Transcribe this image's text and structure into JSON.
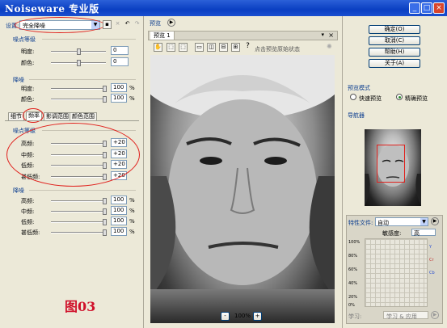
{
  "window": {
    "title": "Noiseware 专业版",
    "buttons": [
      "_",
      "□",
      "×"
    ]
  },
  "settings": {
    "label": "设置:",
    "value": "完全降噪"
  },
  "noise_level": {
    "title": "噪点等级",
    "rows": [
      {
        "label": "明度:",
        "value": "0"
      },
      {
        "label": "颜色:",
        "value": "0"
      }
    ]
  },
  "noise_reduction": {
    "title": "降噪",
    "rows": [
      {
        "label": "明度:",
        "value": "100",
        "unit": "%"
      },
      {
        "label": "颜色:",
        "value": "100",
        "unit": "%"
      }
    ]
  },
  "tabs": [
    "细节",
    "频率",
    "影调范围",
    "颜色范围"
  ],
  "freq_noise": {
    "title": "噪点等级",
    "rows": [
      {
        "label": "高频:",
        "value": "+20"
      },
      {
        "label": "中频:",
        "value": "+20"
      },
      {
        "label": "低频:",
        "value": "+20"
      },
      {
        "label": "甚低频:",
        "value": "+20"
      }
    ]
  },
  "freq_reduction": {
    "title": "降噪",
    "rows": [
      {
        "label": "高频:",
        "value": "100",
        "unit": "%"
      },
      {
        "label": "中频:",
        "value": "100",
        "unit": "%"
      },
      {
        "label": "低频:",
        "value": "100",
        "unit": "%"
      },
      {
        "label": "甚低频:",
        "value": "100",
        "unit": "%"
      }
    ]
  },
  "figure_label": "图03",
  "preview": {
    "section": "预览",
    "tab": "预览 1",
    "hint": "点击预览原始状态",
    "zoom": "100%",
    "minus": "-",
    "plus": "+"
  },
  "actions": {
    "ok": "确定(O)",
    "cancel": "取消(C)",
    "help": "帮助(H)",
    "about": "关于(A)"
  },
  "preview_mode": {
    "title": "预览模式",
    "fast": "快速预览",
    "accurate": "精确预览"
  },
  "navigator": {
    "title": "导航器"
  },
  "profile": {
    "label": "特性文件:",
    "value": "自动",
    "sensitivity_label": "敏感度:",
    "sensitivity_value": "高",
    "y_ticks": [
      "100%",
      "80%",
      "60%",
      "40%",
      "20%",
      "0%"
    ],
    "learn_label": "学习:",
    "learn_value": "学习 & 应用",
    "channels": [
      "Y",
      "Cr",
      "Cb"
    ]
  }
}
